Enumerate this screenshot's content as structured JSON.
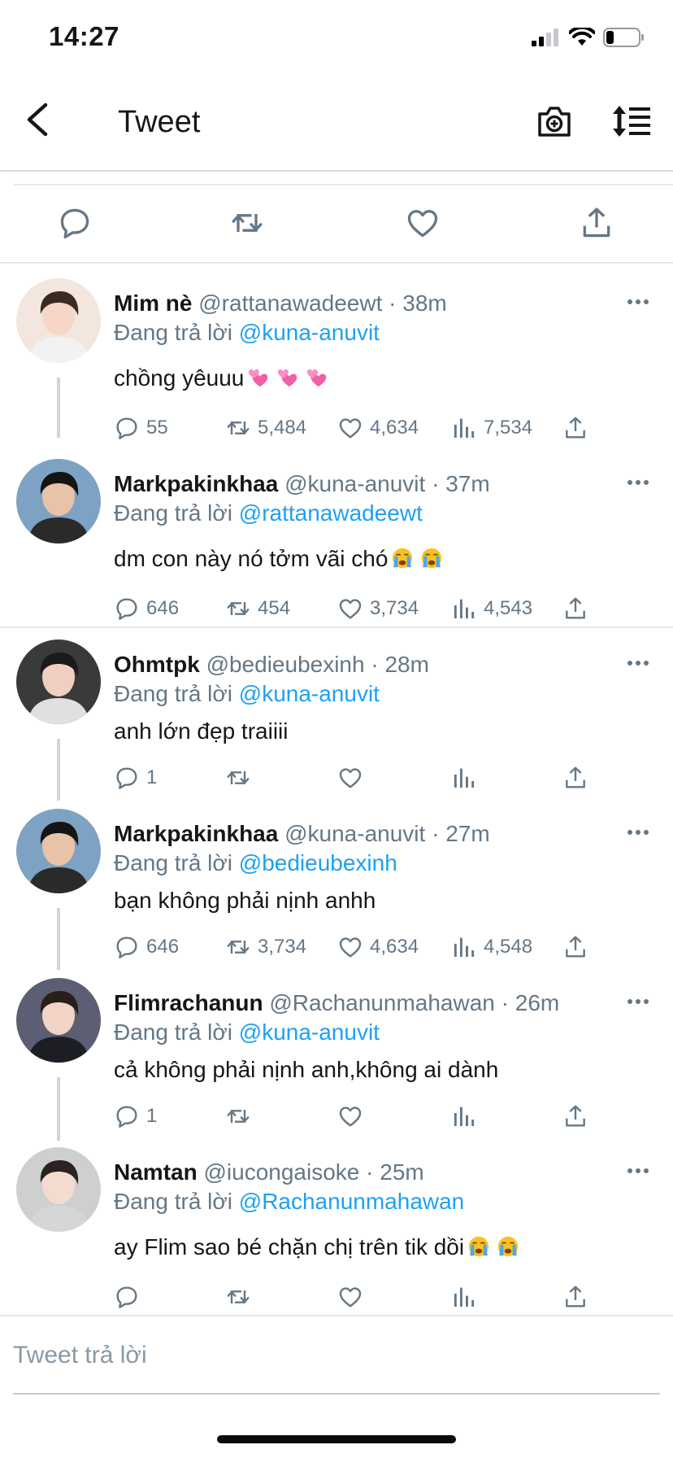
{
  "status_bar": {
    "time": "14:27"
  },
  "header": {
    "title": "Tweet"
  },
  "icons": {
    "back": "chevron-left-icon",
    "camera": "camera-plus-icon",
    "sort": "sort-icon",
    "reply": "reply-icon",
    "retweet": "retweet-icon",
    "like": "heart-icon",
    "views": "bar-chart-icon",
    "share": "share-icon",
    "more": "more-dots-icon"
  },
  "colors": {
    "link": "#1da1f2",
    "muted": "#657786",
    "text": "#14171a",
    "divider": "#e1e8ed"
  },
  "replying_label": "Đang trả lời",
  "replies": [
    {
      "name": "Mim nè",
      "handle": "@rattanawadeewt",
      "time": "38m",
      "replying_to": "@kuna-anuvit",
      "text": "chồng yêuuu",
      "emojis": [
        "two-hearts",
        "two-hearts",
        "two-hearts"
      ],
      "stats": {
        "replies": "55",
        "retweets": "5,484",
        "likes": "4,634",
        "views": "7,534"
      }
    },
    {
      "name": "Markpakinkhaa",
      "handle": "@kuna-anuvit",
      "time": "37m",
      "replying_to": "@rattanawadeewt",
      "text": "dm con này nó tởm vãi chó",
      "emojis": [
        "loudly-crying",
        "loudly-crying"
      ],
      "stats": {
        "replies": "646",
        "retweets": "454",
        "likes": "3,734",
        "views": "4,543"
      }
    },
    {
      "name": "Ohmtpk",
      "handle": "@bedieubexinh",
      "time": "28m",
      "replying_to": "@kuna-anuvit",
      "text": "anh lớn đẹp traiiii",
      "emojis": [],
      "stats": {
        "replies": "1",
        "retweets": "",
        "likes": "",
        "views": ""
      }
    },
    {
      "name": "Markpakinkhaa",
      "handle": "@kuna-anuvit",
      "time": "27m",
      "replying_to": "@bedieubexinh",
      "text": "bạn không phải nịnh anhh",
      "emojis": [],
      "stats": {
        "replies": "646",
        "retweets": "3,734",
        "likes": "4,634",
        "views": "4,548"
      }
    },
    {
      "name": "Flimrachanun",
      "handle": "@Rachanunmahawan",
      "time": "26m",
      "replying_to": "@kuna-anuvit",
      "text": "cả không phải nịnh anh,không ai dành",
      "emojis": [],
      "stats": {
        "replies": "1",
        "retweets": "",
        "likes": "",
        "views": ""
      }
    },
    {
      "name": "Namtan",
      "handle": "@iucongaisoke",
      "time": "25m",
      "replying_to": "@Rachanunmahawan",
      "text": "ay Flim sao bé chặn chị trên tik dồi",
      "emojis": [
        "loudly-crying",
        "loudly-crying"
      ],
      "stats": {
        "replies": "",
        "retweets": "",
        "likes": "",
        "views": ""
      }
    }
  ],
  "reply_input": {
    "placeholder": "Tweet trả lời",
    "value": ""
  }
}
